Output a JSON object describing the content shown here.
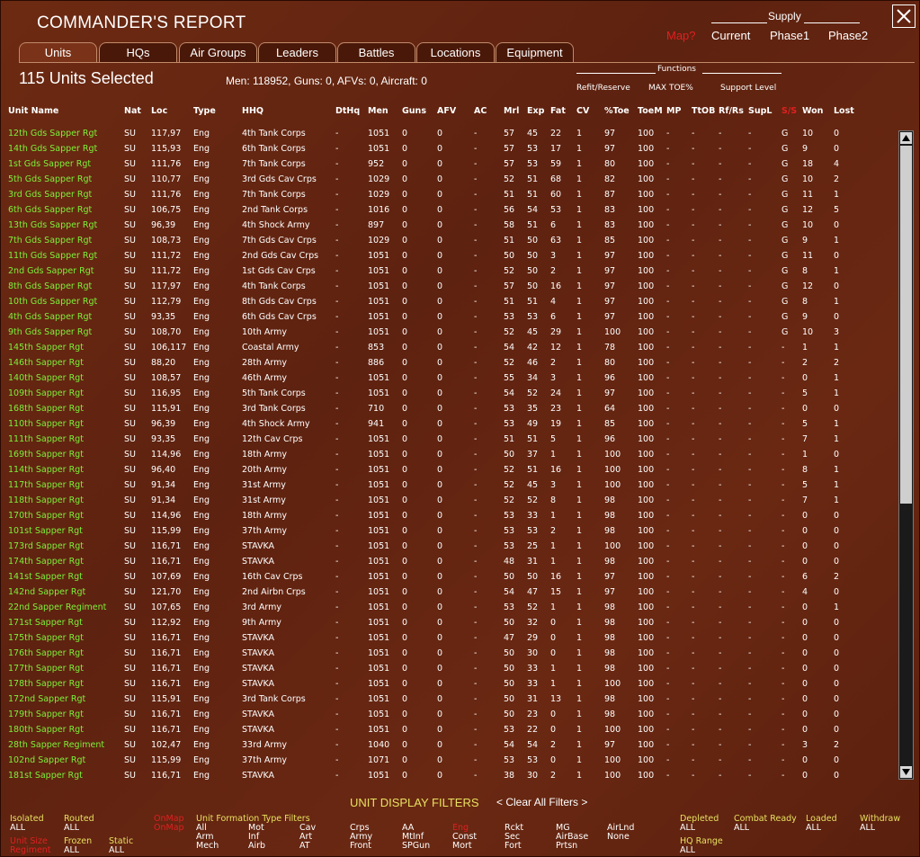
{
  "window": {
    "title": "COMMANDER'S REPORT"
  },
  "supply": {
    "header": "Supply",
    "items": [
      "Map?",
      "Current",
      "Phase1",
      "Phase2"
    ]
  },
  "tabs": [
    "Units",
    "HQs",
    "Air Groups",
    "Leaders",
    "Battles",
    "Locations",
    "Equipment"
  ],
  "selection": {
    "count_label": "115 Units Selected",
    "summary": "Men: 118952, Guns: 0, AFVs: 0, Aircraft: 0"
  },
  "functions": {
    "header": "Functions",
    "items": [
      "Refit/Reserve",
      "MAX TOE%",
      "Support Level"
    ]
  },
  "columns": [
    "Unit Name",
    "Nat",
    "Loc",
    "Type",
    "HHQ",
    "DtHq",
    "Men",
    "Guns",
    "AFV",
    "AC",
    "Mrl",
    "Exp",
    "Fat",
    "CV",
    "%Toe",
    "ToeM",
    "MP",
    "TtOB",
    "Rf/Rs",
    "SupL",
    "S/S",
    "Won",
    "Lost"
  ],
  "rows": [
    [
      "12th Gds Sapper Rgt",
      "SU",
      "117,97",
      "Eng",
      "4th Tank Corps",
      "-",
      "1051",
      "0",
      "0",
      "-",
      "57",
      "45",
      "22",
      "1",
      "97",
      "100",
      "-",
      "-",
      "-",
      "-",
      "G",
      "10",
      "0"
    ],
    [
      "14th Gds Sapper Rgt",
      "SU",
      "115,93",
      "Eng",
      "6th Tank Corps",
      "-",
      "1051",
      "0",
      "0",
      "-",
      "57",
      "53",
      "17",
      "1",
      "97",
      "100",
      "-",
      "-",
      "-",
      "-",
      "G",
      "9",
      "0"
    ],
    [
      "1st Gds Sapper Rgt",
      "SU",
      "111,76",
      "Eng",
      "7th Tank Corps",
      "-",
      "952",
      "0",
      "0",
      "-",
      "57",
      "53",
      "59",
      "1",
      "80",
      "100",
      "-",
      "-",
      "-",
      "-",
      "G",
      "18",
      "4"
    ],
    [
      "5th Gds Sapper Rgt",
      "SU",
      "110,77",
      "Eng",
      "3rd Gds Cav Crps",
      "-",
      "1029",
      "0",
      "0",
      "-",
      "52",
      "51",
      "68",
      "1",
      "82",
      "100",
      "-",
      "-",
      "-",
      "-",
      "G",
      "10",
      "2"
    ],
    [
      "3rd Gds Sapper Rgt",
      "SU",
      "111,76",
      "Eng",
      "7th Tank Corps",
      "-",
      "1029",
      "0",
      "0",
      "-",
      "51",
      "51",
      "60",
      "1",
      "87",
      "100",
      "-",
      "-",
      "-",
      "-",
      "G",
      "11",
      "1"
    ],
    [
      "6th Gds Sapper Rgt",
      "SU",
      "106,75",
      "Eng",
      "2nd Tank Corps",
      "-",
      "1016",
      "0",
      "0",
      "-",
      "56",
      "54",
      "53",
      "1",
      "83",
      "100",
      "-",
      "-",
      "-",
      "-",
      "G",
      "12",
      "5"
    ],
    [
      "13th Gds Sapper Rgt",
      "SU",
      "96,39",
      "Eng",
      "4th Shock Army",
      "-",
      "897",
      "0",
      "0",
      "-",
      "58",
      "51",
      "6",
      "1",
      "83",
      "100",
      "-",
      "-",
      "-",
      "-",
      "G",
      "10",
      "0"
    ],
    [
      "7th Gds Sapper Rgt",
      "SU",
      "108,73",
      "Eng",
      "7th Gds Cav Crps",
      "-",
      "1029",
      "0",
      "0",
      "-",
      "51",
      "50",
      "63",
      "1",
      "85",
      "100",
      "-",
      "-",
      "-",
      "-",
      "G",
      "9",
      "1"
    ],
    [
      "11th Gds Sapper Rgt",
      "SU",
      "111,72",
      "Eng",
      "2nd Gds Cav Crps",
      "-",
      "1051",
      "0",
      "0",
      "-",
      "50",
      "50",
      "3",
      "1",
      "97",
      "100",
      "-",
      "-",
      "-",
      "-",
      "G",
      "11",
      "0"
    ],
    [
      "2nd Gds Sapper Rgt",
      "SU",
      "111,72",
      "Eng",
      "1st Gds Cav Crps",
      "-",
      "1051",
      "0",
      "0",
      "-",
      "52",
      "50",
      "2",
      "1",
      "97",
      "100",
      "-",
      "-",
      "-",
      "-",
      "G",
      "8",
      "1"
    ],
    [
      "8th Gds Sapper Rgt",
      "SU",
      "117,97",
      "Eng",
      "4th Tank Corps",
      "-",
      "1051",
      "0",
      "0",
      "-",
      "57",
      "50",
      "16",
      "1",
      "97",
      "100",
      "-",
      "-",
      "-",
      "-",
      "G",
      "12",
      "0"
    ],
    [
      "10th Gds Sapper Rgt",
      "SU",
      "112,79",
      "Eng",
      "8th Gds Cav Crps",
      "-",
      "1051",
      "0",
      "0",
      "-",
      "51",
      "51",
      "4",
      "1",
      "97",
      "100",
      "-",
      "-",
      "-",
      "-",
      "G",
      "8",
      "1"
    ],
    [
      "4th Gds Sapper Rgt",
      "SU",
      "93,35",
      "Eng",
      "6th Gds Cav Crps",
      "-",
      "1051",
      "0",
      "0",
      "-",
      "53",
      "53",
      "6",
      "1",
      "97",
      "100",
      "-",
      "-",
      "-",
      "-",
      "G",
      "9",
      "0"
    ],
    [
      "9th Gds Sapper Rgt",
      "SU",
      "108,70",
      "Eng",
      "10th Army",
      "-",
      "1051",
      "0",
      "0",
      "-",
      "52",
      "45",
      "29",
      "1",
      "100",
      "100",
      "-",
      "-",
      "-",
      "-",
      "G",
      "10",
      "3"
    ],
    [
      "145th Sapper Rgt",
      "SU",
      "106,117",
      "Eng",
      "Coastal Army",
      "-",
      "853",
      "0",
      "0",
      "-",
      "54",
      "42",
      "12",
      "1",
      "78",
      "100",
      "-",
      "-",
      "-",
      "-",
      "-",
      "1",
      "1"
    ],
    [
      "146th Sapper Rgt",
      "SU",
      "88,20",
      "Eng",
      "28th Army",
      "-",
      "886",
      "0",
      "0",
      "-",
      "52",
      "46",
      "2",
      "1",
      "80",
      "100",
      "-",
      "-",
      "-",
      "-",
      "-",
      "2",
      "2"
    ],
    [
      "140th Sapper Rgt",
      "SU",
      "108,57",
      "Eng",
      "46th Army",
      "-",
      "1051",
      "0",
      "0",
      "-",
      "55",
      "34",
      "3",
      "1",
      "96",
      "100",
      "-",
      "-",
      "-",
      "-",
      "-",
      "0",
      "1"
    ],
    [
      "109th Sapper Rgt",
      "SU",
      "116,95",
      "Eng",
      "5th Tank Corps",
      "-",
      "1051",
      "0",
      "0",
      "-",
      "54",
      "52",
      "24",
      "1",
      "97",
      "100",
      "-",
      "-",
      "-",
      "-",
      "-",
      "5",
      "1"
    ],
    [
      "168th Sapper Rgt",
      "SU",
      "115,91",
      "Eng",
      "3rd Tank Corps",
      "-",
      "710",
      "0",
      "0",
      "-",
      "53",
      "35",
      "23",
      "1",
      "64",
      "100",
      "-",
      "-",
      "-",
      "-",
      "-",
      "0",
      "0"
    ],
    [
      "110th Sapper Rgt",
      "SU",
      "96,39",
      "Eng",
      "4th Shock Army",
      "-",
      "941",
      "0",
      "0",
      "-",
      "53",
      "49",
      "19",
      "1",
      "85",
      "100",
      "-",
      "-",
      "-",
      "-",
      "-",
      "5",
      "1"
    ],
    [
      "111th Sapper Rgt",
      "SU",
      "93,35",
      "Eng",
      "12th Cav Crps",
      "-",
      "1051",
      "0",
      "0",
      "-",
      "51",
      "51",
      "5",
      "1",
      "96",
      "100",
      "-",
      "-",
      "-",
      "-",
      "-",
      "7",
      "1"
    ],
    [
      "169th Sapper Rgt",
      "SU",
      "114,96",
      "Eng",
      "18th Army",
      "-",
      "1051",
      "0",
      "0",
      "-",
      "50",
      "37",
      "1",
      "1",
      "100",
      "100",
      "-",
      "-",
      "-",
      "-",
      "-",
      "1",
      "0"
    ],
    [
      "114th Sapper Rgt",
      "SU",
      "96,40",
      "Eng",
      "20th Army",
      "-",
      "1051",
      "0",
      "0",
      "-",
      "52",
      "51",
      "16",
      "1",
      "100",
      "100",
      "-",
      "-",
      "-",
      "-",
      "-",
      "8",
      "1"
    ],
    [
      "117th Sapper Rgt",
      "SU",
      "91,34",
      "Eng",
      "31st Army",
      "-",
      "1051",
      "0",
      "0",
      "-",
      "52",
      "45",
      "3",
      "1",
      "100",
      "100",
      "-",
      "-",
      "-",
      "-",
      "-",
      "5",
      "1"
    ],
    [
      "118th Sapper Rgt",
      "SU",
      "91,34",
      "Eng",
      "31st Army",
      "-",
      "1051",
      "0",
      "0",
      "-",
      "52",
      "52",
      "8",
      "1",
      "98",
      "100",
      "-",
      "-",
      "-",
      "-",
      "-",
      "7",
      "1"
    ],
    [
      "170th Sapper Rgt",
      "SU",
      "114,96",
      "Eng",
      "18th Army",
      "-",
      "1051",
      "0",
      "0",
      "-",
      "53",
      "33",
      "1",
      "1",
      "98",
      "100",
      "-",
      "-",
      "-",
      "-",
      "-",
      "0",
      "0"
    ],
    [
      "101st Sapper Rgt",
      "SU",
      "115,99",
      "Eng",
      "37th Army",
      "-",
      "1051",
      "0",
      "0",
      "-",
      "53",
      "53",
      "2",
      "1",
      "98",
      "100",
      "-",
      "-",
      "-",
      "-",
      "-",
      "0",
      "0"
    ],
    [
      "173rd Sapper Rgt",
      "SU",
      "116,71",
      "Eng",
      "STAVKA",
      "-",
      "1051",
      "0",
      "0",
      "-",
      "53",
      "25",
      "1",
      "1",
      "100",
      "100",
      "-",
      "-",
      "-",
      "-",
      "-",
      "0",
      "0"
    ],
    [
      "174th Sapper Rgt",
      "SU",
      "116,71",
      "Eng",
      "STAVKA",
      "-",
      "1051",
      "0",
      "0",
      "-",
      "48",
      "31",
      "1",
      "1",
      "98",
      "100",
      "-",
      "-",
      "-",
      "-",
      "-",
      "0",
      "0"
    ],
    [
      "141st Sapper Rgt",
      "SU",
      "107,69",
      "Eng",
      "16th Cav Crps",
      "-",
      "1051",
      "0",
      "0",
      "-",
      "50",
      "50",
      "16",
      "1",
      "97",
      "100",
      "-",
      "-",
      "-",
      "-",
      "-",
      "6",
      "2"
    ],
    [
      "142nd Sapper Rgt",
      "SU",
      "121,70",
      "Eng",
      "2nd Airbn Crps",
      "-",
      "1051",
      "0",
      "0",
      "-",
      "54",
      "47",
      "15",
      "1",
      "97",
      "100",
      "-",
      "-",
      "-",
      "-",
      "-",
      "4",
      "0"
    ],
    [
      "22nd Sapper Regiment",
      "SU",
      "107,65",
      "Eng",
      "3rd Army",
      "-",
      "1051",
      "0",
      "0",
      "-",
      "53",
      "52",
      "1",
      "1",
      "98",
      "100",
      "-",
      "-",
      "-",
      "-",
      "-",
      "0",
      "1"
    ],
    [
      "171st Sapper Rgt",
      "SU",
      "112,92",
      "Eng",
      "9th Army",
      "-",
      "1051",
      "0",
      "0",
      "-",
      "50",
      "32",
      "0",
      "1",
      "98",
      "100",
      "-",
      "-",
      "-",
      "-",
      "-",
      "0",
      "0"
    ],
    [
      "175th Sapper Rgt",
      "SU",
      "116,71",
      "Eng",
      "STAVKA",
      "-",
      "1051",
      "0",
      "0",
      "-",
      "47",
      "29",
      "0",
      "1",
      "98",
      "100",
      "-",
      "-",
      "-",
      "-",
      "-",
      "0",
      "0"
    ],
    [
      "176th Sapper Rgt",
      "SU",
      "116,71",
      "Eng",
      "STAVKA",
      "-",
      "1051",
      "0",
      "0",
      "-",
      "50",
      "30",
      "0",
      "1",
      "98",
      "100",
      "-",
      "-",
      "-",
      "-",
      "-",
      "0",
      "0"
    ],
    [
      "177th Sapper Rgt",
      "SU",
      "116,71",
      "Eng",
      "STAVKA",
      "-",
      "1051",
      "0",
      "0",
      "-",
      "50",
      "33",
      "1",
      "1",
      "98",
      "100",
      "-",
      "-",
      "-",
      "-",
      "-",
      "0",
      "0"
    ],
    [
      "178th Sapper Rgt",
      "SU",
      "116,71",
      "Eng",
      "STAVKA",
      "-",
      "1051",
      "0",
      "0",
      "-",
      "50",
      "33",
      "1",
      "1",
      "100",
      "100",
      "-",
      "-",
      "-",
      "-",
      "-",
      "0",
      "0"
    ],
    [
      "172nd Sapper Rgt",
      "SU",
      "115,91",
      "Eng",
      "3rd Tank Corps",
      "-",
      "1051",
      "0",
      "0",
      "-",
      "50",
      "31",
      "13",
      "1",
      "98",
      "100",
      "-",
      "-",
      "-",
      "-",
      "-",
      "0",
      "0"
    ],
    [
      "179th Sapper Rgt",
      "SU",
      "116,71",
      "Eng",
      "STAVKA",
      "-",
      "1051",
      "0",
      "0",
      "-",
      "50",
      "23",
      "0",
      "1",
      "98",
      "100",
      "-",
      "-",
      "-",
      "-",
      "-",
      "0",
      "0"
    ],
    [
      "180th Sapper Rgt",
      "SU",
      "116,71",
      "Eng",
      "STAVKA",
      "-",
      "1051",
      "0",
      "0",
      "-",
      "53",
      "22",
      "0",
      "1",
      "100",
      "100",
      "-",
      "-",
      "-",
      "-",
      "-",
      "0",
      "0"
    ],
    [
      "28th Sapper Regiment",
      "SU",
      "102,47",
      "Eng",
      "33rd Army",
      "-",
      "1040",
      "0",
      "0",
      "-",
      "54",
      "54",
      "2",
      "1",
      "97",
      "100",
      "-",
      "-",
      "-",
      "-",
      "-",
      "3",
      "2"
    ],
    [
      "102nd Sapper Rgt",
      "SU",
      "115,99",
      "Eng",
      "37th Army",
      "-",
      "1071",
      "0",
      "0",
      "-",
      "53",
      "53",
      "0",
      "1",
      "100",
      "100",
      "-",
      "-",
      "-",
      "-",
      "-",
      "0",
      "0"
    ],
    [
      "181st Sapper Rgt",
      "SU",
      "116,71",
      "Eng",
      "STAVKA",
      "-",
      "1051",
      "0",
      "0",
      "-",
      "38",
      "30",
      "2",
      "1",
      "100",
      "100",
      "-",
      "-",
      "-",
      "-",
      "-",
      "0",
      "0"
    ]
  ],
  "filters": {
    "title": "UNIT DISPLAY FILTERS",
    "clear": "< Clear All Filters >",
    "isolated": {
      "label": "Isolated",
      "value": "ALL"
    },
    "routed": {
      "label": "Routed",
      "value": "ALL"
    },
    "onmap": {
      "label": "OnMap",
      "value": "OnMap"
    },
    "unit_size": {
      "label": "Unit Size",
      "value": "Regiment"
    },
    "frozen": {
      "label": "Frozen",
      "value": "ALL"
    },
    "static": {
      "label": "Static",
      "value": "ALL"
    },
    "formation_header": "Unit  Formation  Type  Filters",
    "col1": [
      "All",
      "Arm",
      "Mech"
    ],
    "col2": [
      "Mot",
      "Inf",
      "Airb"
    ],
    "col3": [
      "Cav",
      "Art",
      "AT"
    ],
    "col4": [
      "Crps",
      "Army",
      "Front"
    ],
    "col5": [
      "AA",
      "MtInf",
      "SPGun"
    ],
    "col6": [
      "Eng",
      "Const",
      "Mort"
    ],
    "col7": [
      "Rckt",
      "Sec",
      "Fort"
    ],
    "col8": [
      "MG",
      "AirBase",
      "Prtsn"
    ],
    "col9": [
      "AirLnd",
      "None"
    ],
    "depleted": {
      "label": "Depleted",
      "value": "ALL"
    },
    "combat_ready": {
      "label": "Combat Ready",
      "value": "ALL"
    },
    "loaded": {
      "label": "Loaded",
      "value": "ALL"
    },
    "withdraw": {
      "label": "Withdraw",
      "value": "ALL"
    },
    "hq_range": {
      "label": "HQ Range",
      "value": "ALL"
    }
  },
  "colors": {
    "unit_name": "#7ef03a",
    "filter_label": "#e8e060",
    "highlight": "#e02020"
  }
}
